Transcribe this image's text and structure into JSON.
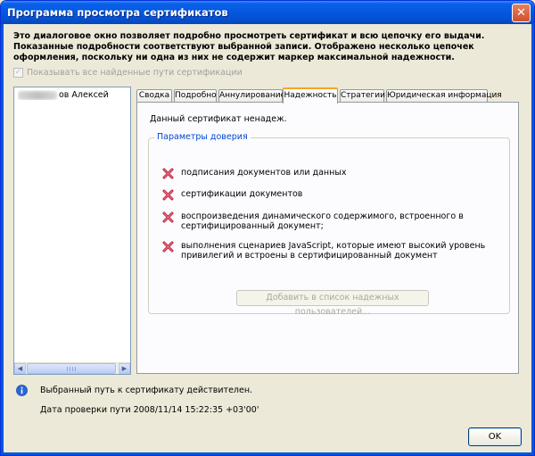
{
  "window": {
    "title": "Программа просмотра сертификатов",
    "close_glyph": "✕"
  },
  "description": "Это диалоговое окно позволяет подробно просмотреть сертификат и всю цепочку его выдачи. Показанные подробности соответствуют выбранной записи. Отображено несколько цепочек оформления, поскольку ни одна из них не содержит маркер максимальной надежности.",
  "show_all_paths": {
    "label": "Показывать все найденные пути сертификации",
    "checked": true,
    "disabled": true
  },
  "tree": {
    "items": [
      {
        "label": "ов Алексей"
      }
    ]
  },
  "tabs": [
    {
      "label": "Сводка",
      "active": false
    },
    {
      "label": "Подробно",
      "active": false
    },
    {
      "label": "Аннулирование",
      "active": false
    },
    {
      "label": "Надежность",
      "active": true
    },
    {
      "label": "Стратегии",
      "active": false
    },
    {
      "label": "Юридическая информация",
      "active": false
    }
  ],
  "trust": {
    "status": "Данный сертификат ненадеж.",
    "group_title": "Параметры доверия",
    "items": [
      {
        "text": "подписания документов или данных",
        "icon": "red-x-icon"
      },
      {
        "text": "сертификации документов",
        "icon": "red-x-icon"
      },
      {
        "text": "воспроизведения динамического содержимого, встроенного в сертифицированный документ;",
        "icon": "red-x-icon"
      },
      {
        "text": "выполнения сценариев JavaScript, которые имеют высокий уровень привилегий и встроены в сертифицированный документ",
        "icon": "red-x-icon"
      }
    ],
    "add_button": "Добавить в список надежных пользователей..."
  },
  "footer": {
    "status": "Выбранный путь к сертификату действителен.",
    "date": "Дата проверки пути 2008/11/14 15:22:35 +03'00'",
    "ok_label": "OK"
  },
  "colors": {
    "titlebar": "#0558e0",
    "accent_tab": "#f5a623",
    "group_title": "#0046d5",
    "error_x": "#c0233a"
  }
}
